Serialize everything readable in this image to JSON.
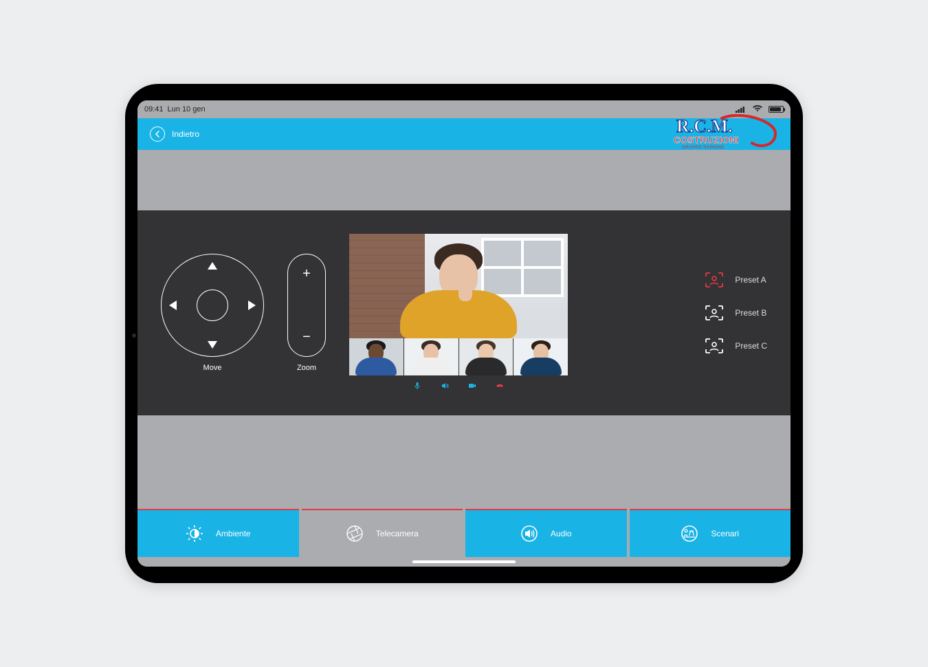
{
  "status": {
    "time": "09:41",
    "date": "Lun 10 gen"
  },
  "topbar": {
    "back_label": "Indietro"
  },
  "logo": {
    "line1": "R.C.M.",
    "line2": "COSTRUZIONI",
    "line3": "GRUPPO RAINONE"
  },
  "controls": {
    "move_label": "Move",
    "zoom_label": "Zoom"
  },
  "presets": [
    {
      "label": "Preset A",
      "active": true
    },
    {
      "label": "Preset B",
      "active": false
    },
    {
      "label": "Preset C",
      "active": false
    }
  ],
  "call_controls": {
    "mic_color": "#19b3e6",
    "speaker_color": "#19b3e6",
    "camera_color": "#19b3e6",
    "hangup_color": "#e53945"
  },
  "tabs": [
    {
      "label": "Ambiente",
      "active": true
    },
    {
      "label": "Telecamera",
      "active": false
    },
    {
      "label": "Audio",
      "active": true
    },
    {
      "label": "Scenari",
      "active": true
    }
  ],
  "colors": {
    "accent": "#19b3e6",
    "danger": "#e53945",
    "panel": "#333234",
    "chrome": "#aaacaf"
  }
}
